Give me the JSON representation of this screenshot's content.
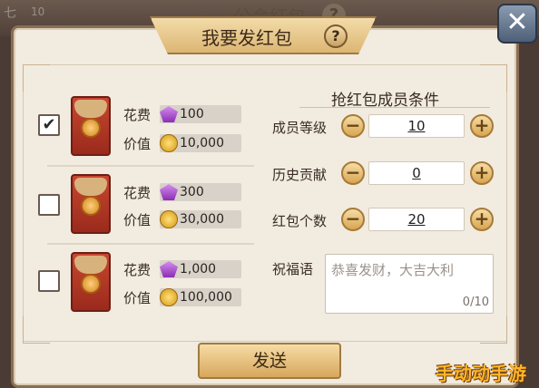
{
  "background": {
    "title": "公会红包",
    "help_icon": "?",
    "top_left_text": "七",
    "top_left_text2": "10"
  },
  "dialog": {
    "title": "我要发红包",
    "help_icon": "?",
    "close_icon": "✕"
  },
  "packets": [
    {
      "checked": true,
      "check_glyph": "✔",
      "cost_label": "花费",
      "cost": "100",
      "value_label": "价值",
      "value": "10,000"
    },
    {
      "checked": false,
      "check_glyph": "",
      "cost_label": "花费",
      "cost": "300",
      "value_label": "价值",
      "value": "30,000"
    },
    {
      "checked": false,
      "check_glyph": "",
      "cost_label": "花费",
      "cost": "1,000",
      "value_label": "价值",
      "value": "100,000"
    }
  ],
  "conditions": {
    "title": "抢红包成员条件",
    "rows": [
      {
        "label": "成员等级",
        "value": "10"
      },
      {
        "label": "历史贡献",
        "value": "0"
      },
      {
        "label": "红包个数",
        "value": "20"
      }
    ],
    "minus": "−",
    "plus": "+"
  },
  "blessing": {
    "label": "祝福语",
    "placeholder": "恭喜发财，大吉大利",
    "counter": "0/10"
  },
  "send_label": "发送",
  "watermark": "手动动手游",
  "colors": {
    "panel": "#f1ebe0",
    "gold": "#d7a75c",
    "red_packet": "#c8472f",
    "gem": "#a844d0"
  }
}
